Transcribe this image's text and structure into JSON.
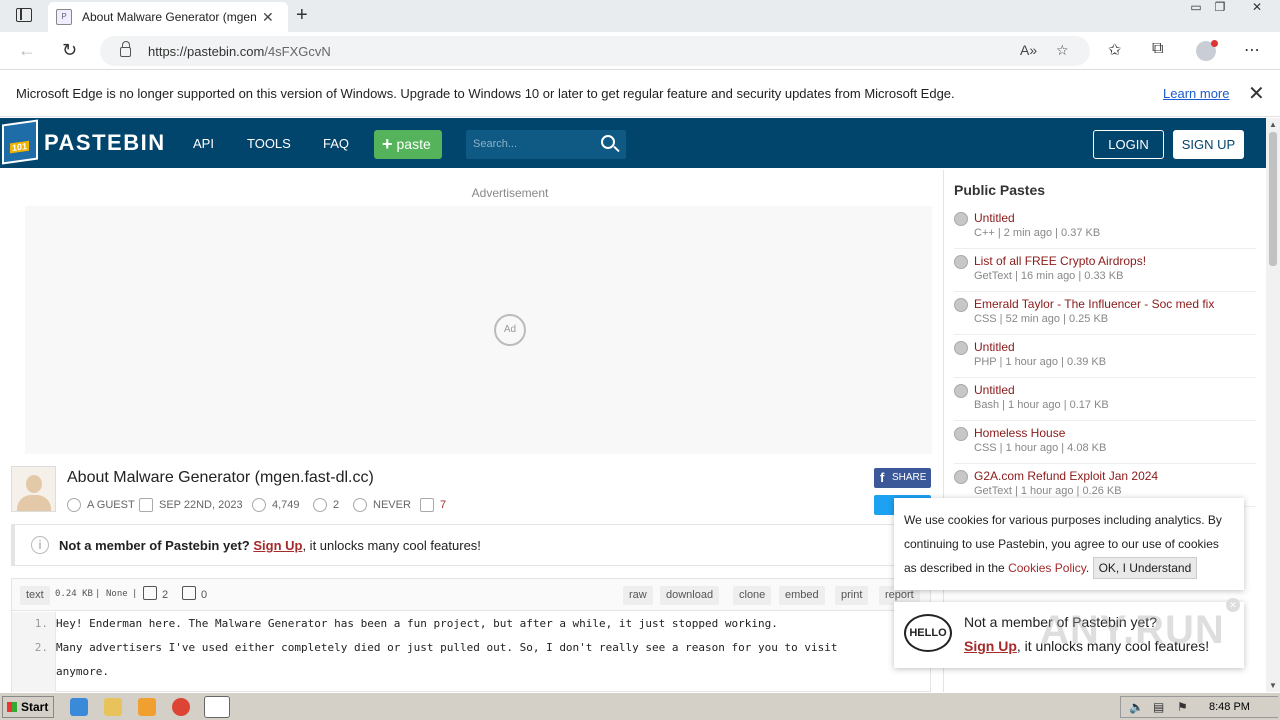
{
  "browser": {
    "tab_title": "About Malware Generator (mgen.fast-dl.cc) - Pastebin.com",
    "url_host": "https://pastebin.com",
    "url_path": "/4sFXGcvN",
    "info_message": "Microsoft Edge is no longer supported on this version of Windows. Upgrade to Windows 10 or later to get regular feature and security updates from Microsoft Edge.",
    "info_link": "Learn more"
  },
  "site": {
    "logo": "PASTEBIN",
    "nav": [
      "API",
      "TOOLS",
      "FAQ"
    ],
    "paste_button": "paste",
    "search_placeholder": "Search...",
    "login": "LOGIN",
    "signup": "SIGN UP"
  },
  "ad": {
    "label": "Advertisement",
    "badge": "Ad"
  },
  "post": {
    "title": "About Malware Generator (mgen.fast-dl.cc)",
    "author": "A GUEST",
    "date": "SEP 22ND, 2023",
    "views": "4,749",
    "stars": "2",
    "expires": "NEVER",
    "comments": "7",
    "share": "SHARE"
  },
  "notice": {
    "bold": "Not a member of Pastebin yet?",
    "link": "Sign Up",
    "rest": ", it unlocks many cool features!"
  },
  "code": {
    "syntax": "text",
    "size": "0.24 KB",
    "category": "None",
    "likes": "2",
    "dislikes": "0",
    "actions": [
      "raw",
      "download",
      "clone",
      "embed",
      "print",
      "report"
    ],
    "lines": [
      {
        "n": "1.",
        "text": "Hey! Enderman here. The Malware Generator has been a fun project, but after a while, it just stopped working."
      },
      {
        "n": "2.",
        "text": "Many advertisers I've used either completely died or just pulled out. So, I don't really see a reason for you to visit"
      },
      {
        "n": "",
        "text": "anymore."
      }
    ]
  },
  "sidebar": {
    "title": "Public Pastes",
    "items": [
      {
        "title": "Untitled",
        "sub": "C++ | 2 min ago | 0.37 KB"
      },
      {
        "title": "List of all FREE Crypto Airdrops!",
        "sub": "GetText | 16 min ago | 0.33 KB"
      },
      {
        "title": "Emerald Taylor - The Influencer - Soc med fix",
        "sub": "CSS | 52 min ago | 0.25 KB"
      },
      {
        "title": "Untitled",
        "sub": "PHP | 1 hour ago | 0.39 KB"
      },
      {
        "title": "Untitled",
        "sub": "Bash | 1 hour ago | 0.17 KB"
      },
      {
        "title": "Homeless House",
        "sub": "CSS | 1 hour ago | 4.08 KB"
      },
      {
        "title": "G2A.com Refund Exploit Jan 2024",
        "sub": "GetText | 1 hour ago | 0.26 KB"
      }
    ]
  },
  "cookie": {
    "text": "We use cookies for various purposes including analytics. By continuing to use Pastebin, you agree to our use of cookies as described in the",
    "link": "Cookies Policy",
    "button": "OK, I Understand"
  },
  "popup": {
    "badge": "HELLO",
    "line1": "Not a member of Pastebin yet?",
    "link": "Sign Up",
    "rest": ", it unlocks many cool features!"
  },
  "watermark": "ANY.RUN",
  "taskbar": {
    "start": "Start",
    "clock": "8:48 PM"
  }
}
